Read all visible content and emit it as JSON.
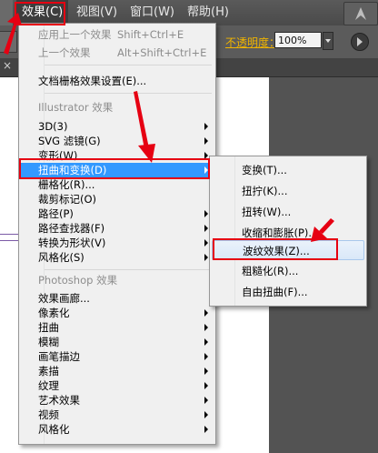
{
  "menubar": {
    "items": [
      {
        "label": "效果(C)",
        "active": true
      },
      {
        "label": "视图(V)"
      },
      {
        "label": "窗口(W)"
      },
      {
        "label": "帮助(H)"
      }
    ]
  },
  "controlbar": {
    "opacity_label": "不透明度：",
    "opacity_value": "100%"
  },
  "effect_menu": {
    "items": [
      {
        "label": "应用上一个效果",
        "shortcut": "Shift+Ctrl+E",
        "disabled": true
      },
      {
        "label": "上一个效果",
        "shortcut": "Alt+Shift+Ctrl+E",
        "disabled": true
      },
      {
        "label": "文档栅格效果设置(E)..."
      },
      {
        "section": "Illustrator 效果"
      },
      {
        "label": "3D(3)",
        "submenu": true
      },
      {
        "label": "SVG 滤镜(G)",
        "submenu": true
      },
      {
        "label": "变形(W)",
        "submenu": true
      },
      {
        "label": "扭曲和变换(D)",
        "submenu": true,
        "highlighted": true
      },
      {
        "label": "栅格化(R)..."
      },
      {
        "label": "裁剪标记(O)"
      },
      {
        "label": "路径(P)",
        "submenu": true
      },
      {
        "label": "路径查找器(F)",
        "submenu": true
      },
      {
        "label": "转换为形状(V)",
        "submenu": true
      },
      {
        "label": "风格化(S)",
        "submenu": true
      },
      {
        "section": "Photoshop 效果"
      },
      {
        "label": "效果画廊..."
      },
      {
        "label": "像素化",
        "submenu": true
      },
      {
        "label": "扭曲",
        "submenu": true
      },
      {
        "label": "模糊",
        "submenu": true
      },
      {
        "label": "画笔描边",
        "submenu": true
      },
      {
        "label": "素描",
        "submenu": true
      },
      {
        "label": "纹理",
        "submenu": true
      },
      {
        "label": "艺术效果",
        "submenu": true
      },
      {
        "label": "视频",
        "submenu": true
      },
      {
        "label": "风格化",
        "submenu": true
      }
    ]
  },
  "distort_submenu": {
    "items": [
      {
        "label": "变换(T)..."
      },
      {
        "label": "扭拧(K)..."
      },
      {
        "label": "扭转(W)..."
      },
      {
        "label": "收缩和膨胀(P)..."
      },
      {
        "label": "波纹效果(Z)...",
        "hovered": true
      },
      {
        "label": "粗糙化(R)..."
      },
      {
        "label": "自由扭曲(F)..."
      }
    ]
  },
  "colors": {
    "annotation_red": "#e60012",
    "menu_highlight": "#3399ff",
    "opacity_label": "#f0b400"
  }
}
